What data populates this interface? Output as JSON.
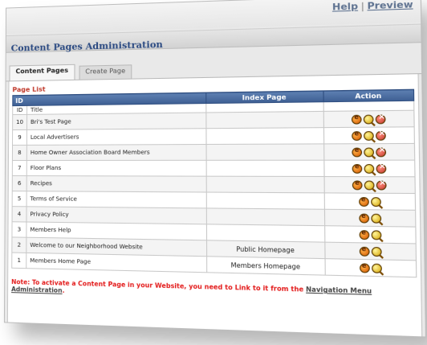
{
  "header": {
    "help_label": "Help",
    "separator": "|",
    "preview_label": "Preview",
    "title": "Content Pages Administration"
  },
  "tabs": [
    {
      "label": "Content Pages",
      "active": true
    },
    {
      "label": "Create Page",
      "active": false
    }
  ],
  "page_list": {
    "legend": "Page List",
    "columns": {
      "id": "ID",
      "title": "Title",
      "index_page": "Index Page",
      "action": "Action"
    },
    "rows": [
      {
        "id": "10",
        "title": "Bri's Test Page",
        "index_page": "",
        "actions": [
          "edit",
          "view",
          "delete"
        ]
      },
      {
        "id": "9",
        "title": "Local Advertisers",
        "index_page": "",
        "actions": [
          "edit",
          "view",
          "delete"
        ]
      },
      {
        "id": "8",
        "title": "Home Owner Association Board Members",
        "index_page": "",
        "actions": [
          "edit",
          "view",
          "delete"
        ]
      },
      {
        "id": "7",
        "title": "Floor Plans",
        "index_page": "",
        "actions": [
          "edit",
          "view",
          "delete"
        ]
      },
      {
        "id": "6",
        "title": "Recipes",
        "index_page": "",
        "actions": [
          "edit",
          "view",
          "delete"
        ]
      },
      {
        "id": "5",
        "title": "Terms of Service",
        "index_page": "",
        "actions": [
          "edit",
          "view"
        ]
      },
      {
        "id": "4",
        "title": "Privacy Policy",
        "index_page": "",
        "actions": [
          "edit",
          "view"
        ]
      },
      {
        "id": "3",
        "title": "Members Help",
        "index_page": "",
        "actions": [
          "edit",
          "view"
        ]
      },
      {
        "id": "2",
        "title": "Welcome to our Neighborhood Website",
        "index_page": "Public Homepage",
        "actions": [
          "edit",
          "view"
        ]
      },
      {
        "id": "1",
        "title": "Members Home Page",
        "index_page": "Members Homepage",
        "actions": [
          "edit",
          "view"
        ]
      }
    ]
  },
  "note": {
    "text": "Note: To activate a Content Page in your Website, you need to Link to it from the ",
    "link_label": "Navigation Menu Administration",
    "suffix": "."
  },
  "icons": {
    "edit": "edit-icon",
    "view": "view-icon",
    "delete": "delete-icon"
  }
}
